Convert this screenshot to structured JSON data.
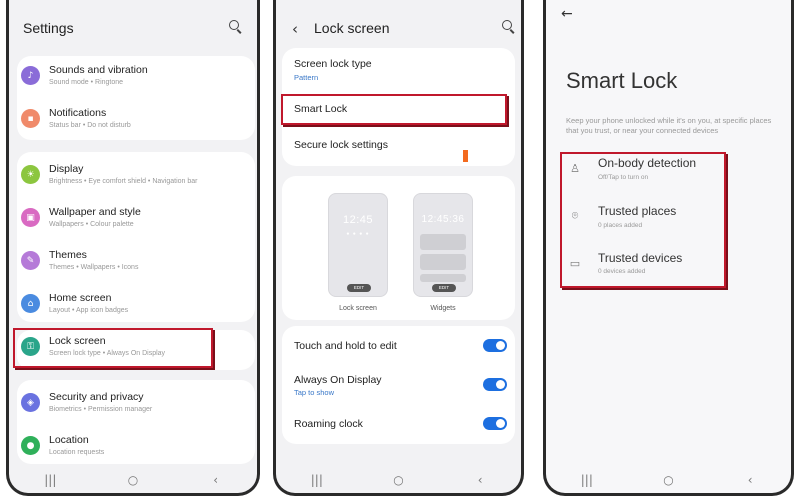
{
  "settings": {
    "title": "Settings",
    "items": [
      {
        "title": "Sounds and vibration",
        "sub": "Sound mode • Ringtone",
        "icon": "speaker-icon",
        "glyph": "♪",
        "color": "#8a6cd8"
      },
      {
        "title": "Notifications",
        "sub": "Status bar • Do not disturb",
        "icon": "bell-icon",
        "glyph": "▪",
        "color": "#f08a6a"
      },
      {
        "title": "Display",
        "sub": "Brightness • Eye comfort shield • Navigation bar",
        "icon": "sun-icon",
        "glyph": "☀",
        "color": "#8cc63f"
      },
      {
        "title": "Wallpaper and style",
        "sub": "Wallpapers • Colour palette",
        "icon": "image-icon",
        "glyph": "▣",
        "color": "#d96ac2"
      },
      {
        "title": "Themes",
        "sub": "Themes • Wallpapers • Icons",
        "icon": "brush-icon",
        "glyph": "✎",
        "color": "#b57ad8"
      },
      {
        "title": "Home screen",
        "sub": "Layout • App icon badges",
        "icon": "home-icon",
        "glyph": "⌂",
        "color": "#4a8be0"
      },
      {
        "title": "Lock screen",
        "sub": "Screen lock type • Always On Display",
        "icon": "lock-icon",
        "glyph": "⚿",
        "color": "#2aa58a"
      },
      {
        "title": "Security and privacy",
        "sub": "Biometrics • Permission manager",
        "icon": "shield-icon",
        "glyph": "◈",
        "color": "#6a72e0"
      },
      {
        "title": "Location",
        "sub": "Location requests",
        "icon": "location-pin-icon",
        "glyph": "●",
        "color": "#2fb05a"
      }
    ]
  },
  "lockscreen": {
    "title": "Lock screen",
    "screen_lock_type": "Screen lock type",
    "screen_lock_value": "Pattern",
    "smart_lock": "Smart Lock",
    "secure_lock": "Secure lock settings",
    "preview_lock_time": "12:45",
    "preview_widgets_time": "12:45:36",
    "preview_edit": "EDIT",
    "preview_lock_label": "Lock screen",
    "preview_widgets_label": "Widgets",
    "touch_hold": "Touch and hold to edit",
    "aod": "Always On Display",
    "aod_sub": "Tap to show",
    "roaming": "Roaming clock",
    "toggles": {
      "touch_hold": true,
      "aod": true,
      "roaming": true
    }
  },
  "smartlock": {
    "title": "Smart Lock",
    "description": "Keep your phone unlocked while it's on you, at specific places that you trust, or near your connected devices",
    "options": [
      {
        "title": "On-body detection",
        "sub": "Off/Tap to turn on",
        "icon": "walking-person-icon",
        "glyph": "🚶"
      },
      {
        "title": "Trusted places",
        "sub": "0 places added",
        "icon": "location-pin-icon",
        "glyph": "⌾"
      },
      {
        "title": "Trusted devices",
        "sub": "0 devices added",
        "icon": "devices-icon",
        "glyph": "▭"
      }
    ]
  },
  "navbar": {
    "recents": "|||",
    "home": "○",
    "back": "‹"
  },
  "colors": {
    "highlight": "#c0182c",
    "toggle_on": "#1d6fe0",
    "link": "#3a78c8"
  }
}
